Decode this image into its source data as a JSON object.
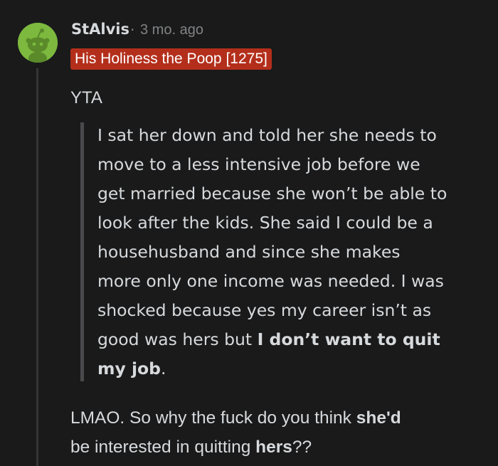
{
  "comment": {
    "username": "StAlvis",
    "separator": "·",
    "timestamp": "3 mo. ago",
    "flair": "His Holiness the Poop [1275]",
    "verdict": "YTA",
    "quote_lines": [
      "I sat her down and told her she needs to",
      "move to a less intensive job before we",
      "get married because she won’t be able to",
      "look after the kids. She said I could be a",
      "househusband and since she makes",
      "more only one income was needed. I was",
      "shocked because yes my career isn’t as"
    ],
    "quote_line8_plain": "good was hers but ",
    "quote_line8_bold": "I don’t want to quit",
    "quote_line9_bold": "my job",
    "quote_line9_end": ".",
    "reply_line1_plain": "LMAO. So why the fuck do you think ",
    "reply_line1_bold": "she'd",
    "reply_line2_plain": "be interested in quitting ",
    "reply_line2_bold": "hers",
    "reply_line2_end": "??"
  },
  "colors": {
    "background": "#1a1a1b",
    "text": "#d7dadc",
    "muted": "#818384",
    "flair_bg": "#b32f1b",
    "avatar_bg": "#7cb93e"
  },
  "icons": {
    "avatar": "snoo-avatar-icon"
  }
}
